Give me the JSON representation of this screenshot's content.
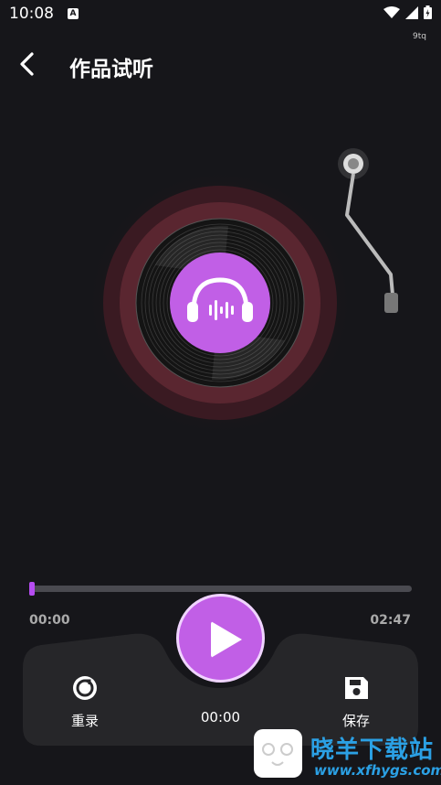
{
  "status_bar": {
    "time": "10:08",
    "app_icon": "A",
    "sub_label": "9tq"
  },
  "header": {
    "title": "作品试听",
    "back_icon": "chevron-left-icon"
  },
  "player": {
    "progress": 0.003,
    "current_time": "00:00",
    "total_time": "02:47",
    "elapsed": "00:00",
    "accent_color": "#c15fe6"
  },
  "controls": {
    "rerecord_label": "重录",
    "save_label": "保存"
  },
  "watermark": {
    "name": "晓羊下载站",
    "url": "www.xfhygs.com"
  }
}
